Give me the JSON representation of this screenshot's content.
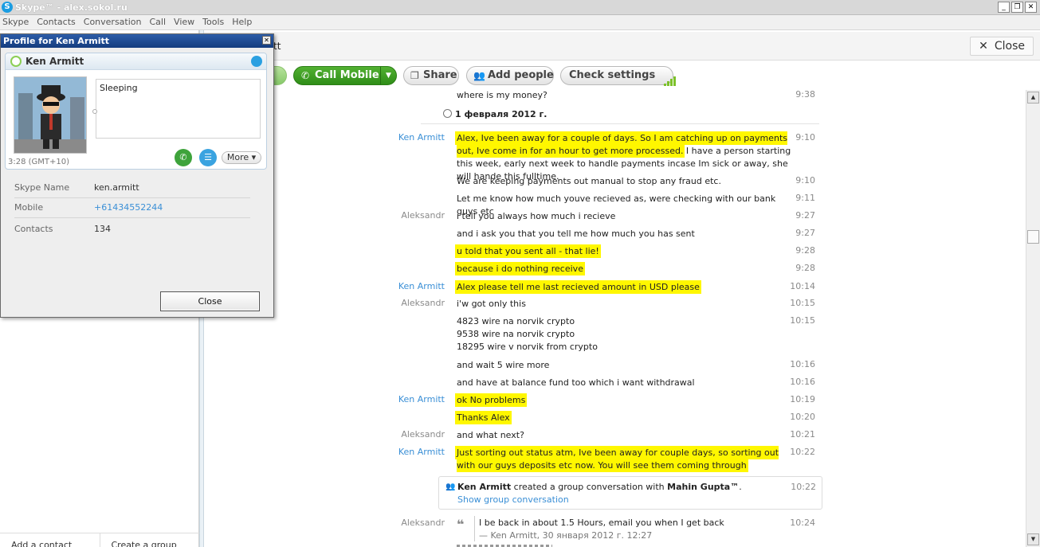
{
  "window": {
    "title": "Skype™ - alex.sokol.ru",
    "controls": [
      "_",
      "❐",
      "✕"
    ]
  },
  "menu": [
    "Skype",
    "Contacts",
    "Conversation",
    "Call",
    "View",
    "Tools",
    "Help"
  ],
  "sidebar": {
    "add_contact": "Add a contact",
    "create_group": "Create a group"
  },
  "header": {
    "conversation_title_partial": "tt",
    "close_label": "Close"
  },
  "toolbar": {
    "call_mobile": "Call Mobile",
    "share": "Share",
    "add_people": "Add people",
    "check_settings": "Check settings"
  },
  "chat": {
    "prev_message": {
      "text": "where is my money?",
      "time": "9:38"
    },
    "date_header": "1 февраля 2012 г.",
    "messages": [
      {
        "author": "Ken Armitt",
        "author_class": "ken",
        "text": "Alex, Ive been away for a couple of days. So I am catching up on payments out, Ive come in for an hour to get more processed. I have a person starting this week, early next week to handle payments incase Im sick or away, she will hande this fulltime.",
        "time": "9:10"
      },
      {
        "author": "",
        "author_class": "ken",
        "text": "We are keeping payments out manual to stop any fraud etc.",
        "time": "9:10"
      },
      {
        "author": "",
        "author_class": "ken",
        "text": "Let me know how much youve recieved as, were checking with our bank guys etc",
        "time": "9:11"
      },
      {
        "author": "Aleksandr",
        "author_class": "",
        "text": "i tell you always how much i recieve",
        "time": "9:27"
      },
      {
        "author": "",
        "author_class": "",
        "text": "and i ask you that you tell me how much you has sent",
        "time": "9:27"
      },
      {
        "author": "",
        "author_class": "",
        "text": "u told that you sent all - that lie!",
        "time": "9:28"
      },
      {
        "author": "",
        "author_class": "",
        "text": "because i do nothing receive",
        "time": "9:28"
      },
      {
        "author": "Ken Armitt",
        "author_class": "ken",
        "text": "Alex please tell me last recieved amount in USD please",
        "time": "10:14"
      },
      {
        "author": "Aleksandr",
        "author_class": "",
        "text": "i'w got only this",
        "time": "10:15"
      },
      {
        "author": "",
        "author_class": "",
        "text": "4823 wire na norvik crypto\n9538 wire na norvik crypto\n18295 wire v norvik from crypto",
        "time": "10:15"
      },
      {
        "author": "",
        "author_class": "",
        "text": "and wait 5 wire more",
        "time": "10:16"
      },
      {
        "author": "",
        "author_class": "",
        "text": "and have at balance fund too which i want withdrawal",
        "time": "10:16"
      },
      {
        "author": "Ken Armitt",
        "author_class": "ken",
        "text": "ok No problems",
        "time": "10:19"
      },
      {
        "author": "",
        "author_class": "ken",
        "text": "Thanks Alex",
        "time": "10:20"
      },
      {
        "author": "Aleksandr",
        "author_class": "",
        "text": "and what next?",
        "time": "10:21"
      },
      {
        "author": "Ken Armitt",
        "author_class": "ken",
        "text": "Just sorting out status atm, Ive been away for couple days, so sorting out with our guys deposits etc now. You will see them coming through",
        "time": "10:22"
      }
    ],
    "group_event": {
      "actor": "Ken Armitt",
      "action": "created a group conversation with",
      "target": "Mahin Gupta™",
      "link": "Show group conversation",
      "time": "10:22"
    },
    "quoted": {
      "author": "Aleksandr",
      "text": "I be back in about 1.5 Hours, email you when I get back",
      "meta": "— Ken Armitt, 30 января 2012 г. 12:27",
      "time": "10:24"
    }
  },
  "profile": {
    "window_title": "Profile for Ken Armitt",
    "name": "Ken Armitt",
    "mood": "Sleeping",
    "local_time": "3:28 (GMT+10)",
    "more_label": "More",
    "fields": [
      {
        "key": "Skype Name",
        "value": "ken.armitt",
        "is_link": false
      },
      {
        "key": "Mobile",
        "value": "+61434552244",
        "is_link": true
      },
      {
        "key": "Contacts",
        "value": "134",
        "is_link": false
      }
    ],
    "close_label": "Close"
  },
  "colors": {
    "highlight": "#fff700",
    "skype_blue": "#1b9de2",
    "call_green": "#3ea33b",
    "link_blue": "#3a8fd6"
  }
}
